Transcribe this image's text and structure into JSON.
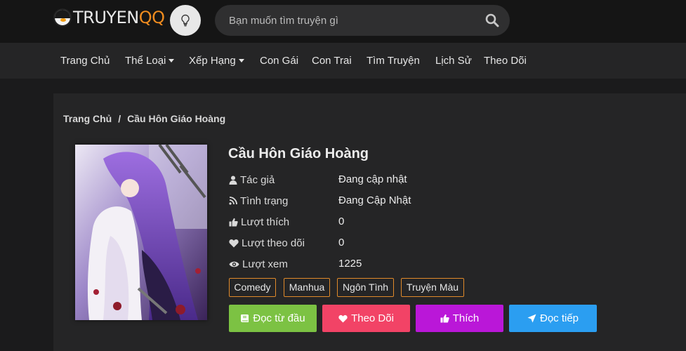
{
  "header": {
    "logo_primary": "TRUYEN",
    "logo_accent": "QQ",
    "theme_icon": "lightbulb-icon",
    "search": {
      "placeholder": "Bạn muốn tìm truyện gì",
      "icon": "search-icon"
    }
  },
  "nav": [
    {
      "label": "Trang Chủ",
      "dropdown": false
    },
    {
      "label": "Thể Loại",
      "dropdown": true
    },
    {
      "label": "Xếp Hạng",
      "dropdown": true
    },
    {
      "label": "Con Gái",
      "dropdown": false
    },
    {
      "label": "Con Trai",
      "dropdown": false
    },
    {
      "label": "Tìm Truyện",
      "dropdown": false
    },
    {
      "label": "Lịch Sử",
      "dropdown": false
    },
    {
      "label": "Theo Dõi",
      "dropdown": false
    }
  ],
  "breadcrumb": {
    "home": "Trang Chủ",
    "separator": "/",
    "current": "Cầu Hôn Giáo Hoàng"
  },
  "comic": {
    "title": "Cầu Hôn Giáo Hoàng",
    "info": [
      {
        "icon": "user-icon",
        "label": "Tác giả",
        "value": "Đang cập nhật"
      },
      {
        "icon": "rss-icon",
        "label": "Tình trạng",
        "value": "Đang Cập Nhật"
      },
      {
        "icon": "thumbs-up-icon",
        "label": "Lượt thích",
        "value": "0"
      },
      {
        "icon": "heart-icon",
        "label": "Lượt theo dõi",
        "value": "0"
      },
      {
        "icon": "eye-icon",
        "label": "Lượt xem",
        "value": "1225"
      }
    ],
    "tags": [
      "Comedy",
      "Manhua",
      "Ngôn Tình",
      "Truyện Màu"
    ]
  },
  "actions": [
    {
      "label": "Đọc từ đầu",
      "icon": "book-icon",
      "color": "#7cc243"
    },
    {
      "label": "Theo Dõi",
      "icon": "heart-icon",
      "color": "#f24366"
    },
    {
      "label": "Thích",
      "icon": "thumbs-up-icon",
      "color": "#ba17d8"
    },
    {
      "label": "Đọc tiếp",
      "icon": "send-icon",
      "color": "#2b9ef1"
    }
  ],
  "colors": {
    "accent": "#f08c1f",
    "tag_border": "#e08a2a",
    "background": "#1b1b1c",
    "panel": "#252526"
  }
}
